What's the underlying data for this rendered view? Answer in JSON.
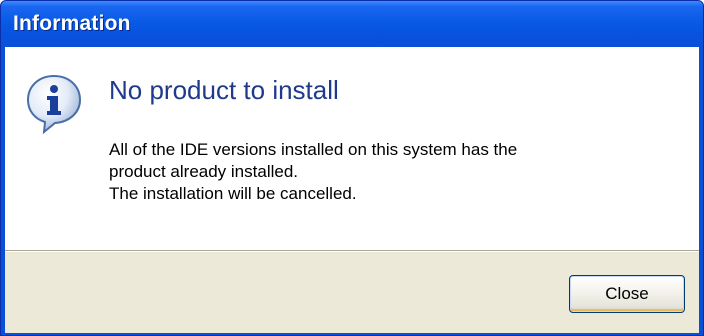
{
  "window": {
    "title": "Information"
  },
  "dialog": {
    "icon": "information-icon",
    "heading": "No product to install",
    "message_lines": [
      "All of the IDE versions installed on this system has the",
      "product already installed.",
      "The installation will be cancelled."
    ]
  },
  "buttons": {
    "close_label": "Close"
  },
  "colors": {
    "titlebar": "#0a5ae6",
    "heading": "#1f3a8a",
    "footer_bg": "#ece9d8"
  }
}
